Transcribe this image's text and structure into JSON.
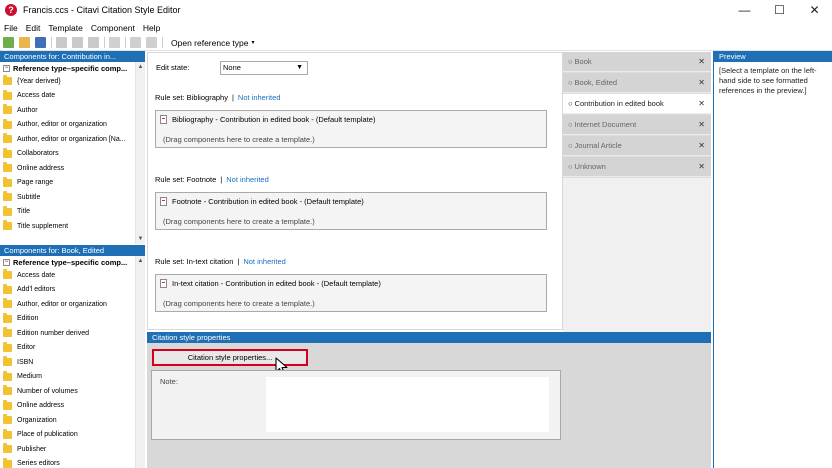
{
  "window": {
    "title": "Francis.ccs - Citavi Citation Style Editor",
    "app_icon": "?",
    "minimize": "—",
    "maximize": "☐",
    "close": "✕"
  },
  "menu": [
    "File",
    "Edit",
    "Template",
    "Component",
    "Help"
  ],
  "toolbar": {
    "icons": [
      "new-icon",
      "open-icon",
      "save-icon",
      "cut-icon",
      "copy-icon",
      "paste-icon",
      "delete-icon",
      "undo-icon",
      "redo-icon"
    ],
    "open_reference_type": "Open reference type",
    "caret": "▾"
  },
  "components_top": {
    "header": "Components for: Contribution in...",
    "root": "Reference  type–specific  comp...",
    "items": [
      "{Year derived}",
      "Access date",
      "Author",
      "Author, editor or organization",
      "Author,  editor  or  organization  [Na...",
      "Collaborators",
      "Online address",
      "Page range",
      "Subtitle",
      "Title",
      "Title supplement"
    ]
  },
  "components_bottom": {
    "header": "Components for: Book, Edited",
    "root": "Reference  type–specific  comp...",
    "items": [
      "Access date",
      "Add'l editors",
      "Author, editor or organization",
      "Edition",
      "Edition number derived",
      "Editor",
      "ISBN",
      "Medium",
      "Number of volumes",
      "Online address",
      "Organization",
      "Place of publication",
      "Publisher",
      "Series editors"
    ]
  },
  "editor": {
    "edit_state_label": "Edit state:",
    "edit_state_value": "None",
    "rulesets": [
      {
        "label": "Rule set: Bibliography",
        "link": "Not inherited",
        "template": "Bibliography - Contribution in edited book - (Default template)",
        "hint": "(Drag components here to create a template.)"
      },
      {
        "label": "Rule set: Footnote",
        "link": "Not inherited",
        "template": "Footnote - Contribution in edited book - (Default template)",
        "hint": "(Drag components here to create a template.)"
      },
      {
        "label": "Rule set: In-text citation",
        "link": "Not inherited",
        "template": "In-text citation - Contribution in edited book - (Default template)",
        "hint": "(Drag components here to create a template.)"
      }
    ]
  },
  "reference_types": [
    {
      "label": "Book",
      "active": false
    },
    {
      "label": "Book, Edited",
      "active": false
    },
    {
      "label": "Contribution in edited book",
      "active": true
    },
    {
      "label": "Internet Document",
      "active": false
    },
    {
      "label": "Journal Article",
      "active": false
    },
    {
      "label": "Unknown",
      "active": false
    }
  ],
  "preview": {
    "header": "Preview",
    "text": "[Select a template on the left-hand side to see formatted references in the preview.]"
  },
  "citation_style_properties": {
    "header": "Citation style properties",
    "button": "Citation style properties...",
    "note_label": "Note:"
  },
  "colors": {
    "accent": "#1e6fb5",
    "highlight": "#d6001c",
    "folder": "#f2c230",
    "link": "#1a6fc4"
  }
}
